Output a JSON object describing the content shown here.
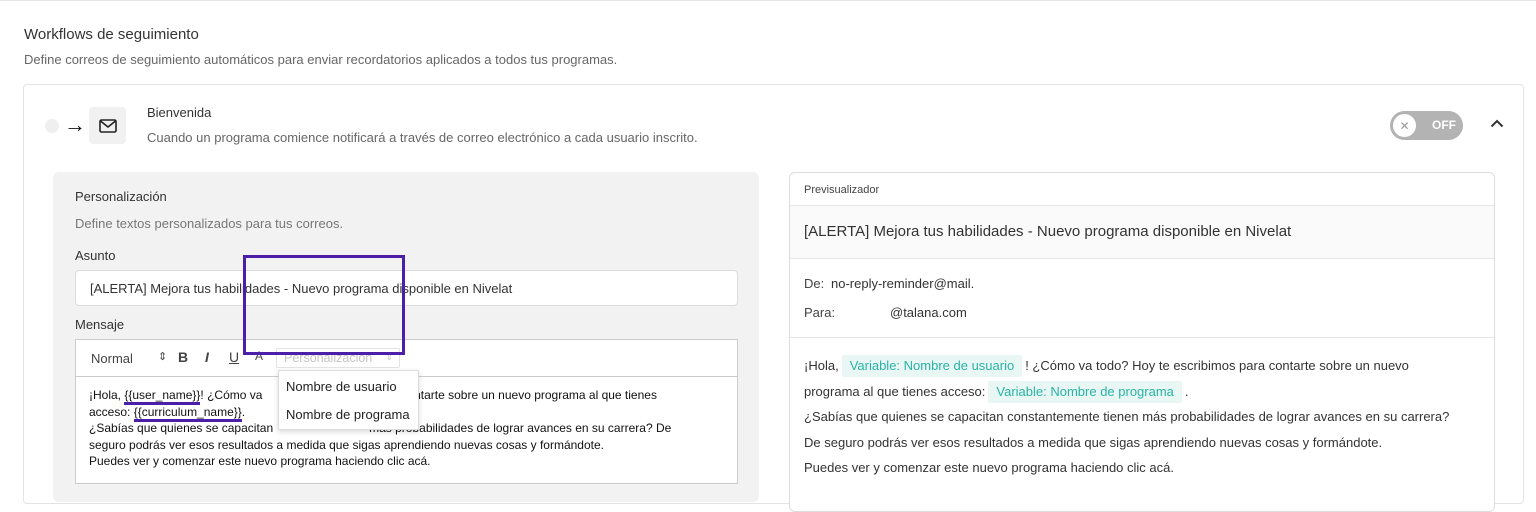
{
  "section": {
    "title": "Workflows de seguimiento",
    "description": "Define correos de seguimiento automáticos para enviar recordatorios aplicados a todos tus programas."
  },
  "workflow": {
    "title": "Bienvenida",
    "description": "Cuando un programa comience notificará a través de correo electrónico a cada usuario inscrito.",
    "toggle_label": "OFF",
    "toggle_state": "off"
  },
  "personalizacion": {
    "title": "Personalización",
    "description": "Define textos personalizados para tus correos.",
    "subject_label": "Asunto",
    "subject_value": "[ALERTA] Mejora tus habilidades - Nuevo programa disponible en Nivelat",
    "message_label": "Mensaje",
    "toolbar": {
      "format": "Normal",
      "bold": "B",
      "italic": "I",
      "underline": "U",
      "color": "A",
      "personalization_placeholder": "Personalización"
    },
    "dropdown": [
      "Nombre de usuario",
      "Nombre de programa"
    ],
    "message": {
      "l1_pre": "¡Hola, ",
      "var_user": "{{user_name}}",
      "l1_post": "! ¿Cómo va",
      "l1_tail": "ra contarte sobre un nuevo programa al que tienes",
      "l2_pre": "acceso: ",
      "var_curriculum": "{{curriculum_name}}",
      "l2_post": ".",
      "l3_a": "¿Sabías que quienes se capacitan",
      "l3_b": "más probabilidades de lograr avances en su carrera? De",
      "l4": "seguro podrás ver esos resultados a medida que sigas aprendiendo nuevas cosas y formándote.",
      "l5": "Puedes ver y comenzar este nuevo programa haciendo clic acá."
    }
  },
  "preview": {
    "header": "Previsualizador",
    "subject": "[ALERTA] Mejora tus habilidades - Nuevo programa disponible en Nivelat",
    "from_label": "De:",
    "from_value": "no-reply-reminder@mail.",
    "to_label": "Para:",
    "to_value": "@talana.com",
    "body": {
      "greeting": "¡Hola,",
      "chip_user": "Variable: Nombre de usuario",
      "after_user": "! ¿Cómo va todo? Hoy te escribimos para contarte sobre un nuevo",
      "line2": "programa al que tienes acceso:",
      "chip_program": "Variable: Nombre de programa",
      "line2_end": ".",
      "line3": "¿Sabías que quienes se capacitan constantemente tienen más probabilidades de lograr avances en su carrera?",
      "line4": "De seguro podrás ver esos resultados a medida que sigas aprendiendo nuevas cosas y formándote.",
      "line5": "Puedes ver y comenzar este nuevo programa haciendo clic acá."
    }
  },
  "colors": {
    "highlight": "#4b1fa8",
    "chip_bg": "#e8f6f4",
    "chip_text": "#2ab3a6",
    "toggle_off": "#b3b3b3"
  },
  "icons": [
    "arrow-right-icon",
    "mail-icon",
    "close-icon",
    "chevron-up-icon",
    "sort-icon",
    "text-color-icon"
  ]
}
